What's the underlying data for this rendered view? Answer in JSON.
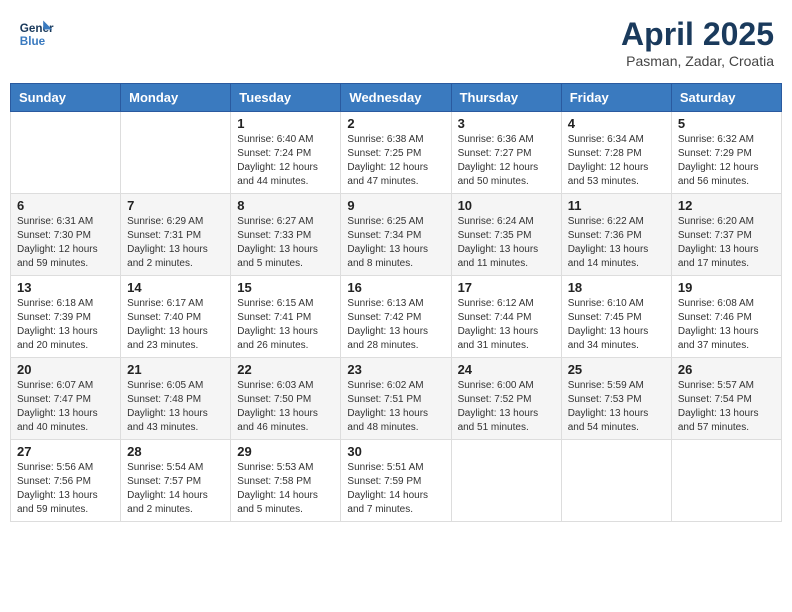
{
  "header": {
    "logo_line1": "General",
    "logo_line2": "Blue",
    "month_title": "April 2025",
    "location": "Pasman, Zadar, Croatia"
  },
  "weekdays": [
    "Sunday",
    "Monday",
    "Tuesday",
    "Wednesday",
    "Thursday",
    "Friday",
    "Saturday"
  ],
  "weeks": [
    [
      {
        "day": "",
        "info": ""
      },
      {
        "day": "",
        "info": ""
      },
      {
        "day": "1",
        "info": "Sunrise: 6:40 AM\nSunset: 7:24 PM\nDaylight: 12 hours and 44 minutes."
      },
      {
        "day": "2",
        "info": "Sunrise: 6:38 AM\nSunset: 7:25 PM\nDaylight: 12 hours and 47 minutes."
      },
      {
        "day": "3",
        "info": "Sunrise: 6:36 AM\nSunset: 7:27 PM\nDaylight: 12 hours and 50 minutes."
      },
      {
        "day": "4",
        "info": "Sunrise: 6:34 AM\nSunset: 7:28 PM\nDaylight: 12 hours and 53 minutes."
      },
      {
        "day": "5",
        "info": "Sunrise: 6:32 AM\nSunset: 7:29 PM\nDaylight: 12 hours and 56 minutes."
      }
    ],
    [
      {
        "day": "6",
        "info": "Sunrise: 6:31 AM\nSunset: 7:30 PM\nDaylight: 12 hours and 59 minutes."
      },
      {
        "day": "7",
        "info": "Sunrise: 6:29 AM\nSunset: 7:31 PM\nDaylight: 13 hours and 2 minutes."
      },
      {
        "day": "8",
        "info": "Sunrise: 6:27 AM\nSunset: 7:33 PM\nDaylight: 13 hours and 5 minutes."
      },
      {
        "day": "9",
        "info": "Sunrise: 6:25 AM\nSunset: 7:34 PM\nDaylight: 13 hours and 8 minutes."
      },
      {
        "day": "10",
        "info": "Sunrise: 6:24 AM\nSunset: 7:35 PM\nDaylight: 13 hours and 11 minutes."
      },
      {
        "day": "11",
        "info": "Sunrise: 6:22 AM\nSunset: 7:36 PM\nDaylight: 13 hours and 14 minutes."
      },
      {
        "day": "12",
        "info": "Sunrise: 6:20 AM\nSunset: 7:37 PM\nDaylight: 13 hours and 17 minutes."
      }
    ],
    [
      {
        "day": "13",
        "info": "Sunrise: 6:18 AM\nSunset: 7:39 PM\nDaylight: 13 hours and 20 minutes."
      },
      {
        "day": "14",
        "info": "Sunrise: 6:17 AM\nSunset: 7:40 PM\nDaylight: 13 hours and 23 minutes."
      },
      {
        "day": "15",
        "info": "Sunrise: 6:15 AM\nSunset: 7:41 PM\nDaylight: 13 hours and 26 minutes."
      },
      {
        "day": "16",
        "info": "Sunrise: 6:13 AM\nSunset: 7:42 PM\nDaylight: 13 hours and 28 minutes."
      },
      {
        "day": "17",
        "info": "Sunrise: 6:12 AM\nSunset: 7:44 PM\nDaylight: 13 hours and 31 minutes."
      },
      {
        "day": "18",
        "info": "Sunrise: 6:10 AM\nSunset: 7:45 PM\nDaylight: 13 hours and 34 minutes."
      },
      {
        "day": "19",
        "info": "Sunrise: 6:08 AM\nSunset: 7:46 PM\nDaylight: 13 hours and 37 minutes."
      }
    ],
    [
      {
        "day": "20",
        "info": "Sunrise: 6:07 AM\nSunset: 7:47 PM\nDaylight: 13 hours and 40 minutes."
      },
      {
        "day": "21",
        "info": "Sunrise: 6:05 AM\nSunset: 7:48 PM\nDaylight: 13 hours and 43 minutes."
      },
      {
        "day": "22",
        "info": "Sunrise: 6:03 AM\nSunset: 7:50 PM\nDaylight: 13 hours and 46 minutes."
      },
      {
        "day": "23",
        "info": "Sunrise: 6:02 AM\nSunset: 7:51 PM\nDaylight: 13 hours and 48 minutes."
      },
      {
        "day": "24",
        "info": "Sunrise: 6:00 AM\nSunset: 7:52 PM\nDaylight: 13 hours and 51 minutes."
      },
      {
        "day": "25",
        "info": "Sunrise: 5:59 AM\nSunset: 7:53 PM\nDaylight: 13 hours and 54 minutes."
      },
      {
        "day": "26",
        "info": "Sunrise: 5:57 AM\nSunset: 7:54 PM\nDaylight: 13 hours and 57 minutes."
      }
    ],
    [
      {
        "day": "27",
        "info": "Sunrise: 5:56 AM\nSunset: 7:56 PM\nDaylight: 13 hours and 59 minutes."
      },
      {
        "day": "28",
        "info": "Sunrise: 5:54 AM\nSunset: 7:57 PM\nDaylight: 14 hours and 2 minutes."
      },
      {
        "day": "29",
        "info": "Sunrise: 5:53 AM\nSunset: 7:58 PM\nDaylight: 14 hours and 5 minutes."
      },
      {
        "day": "30",
        "info": "Sunrise: 5:51 AM\nSunset: 7:59 PM\nDaylight: 14 hours and 7 minutes."
      },
      {
        "day": "",
        "info": ""
      },
      {
        "day": "",
        "info": ""
      },
      {
        "day": "",
        "info": ""
      }
    ]
  ]
}
